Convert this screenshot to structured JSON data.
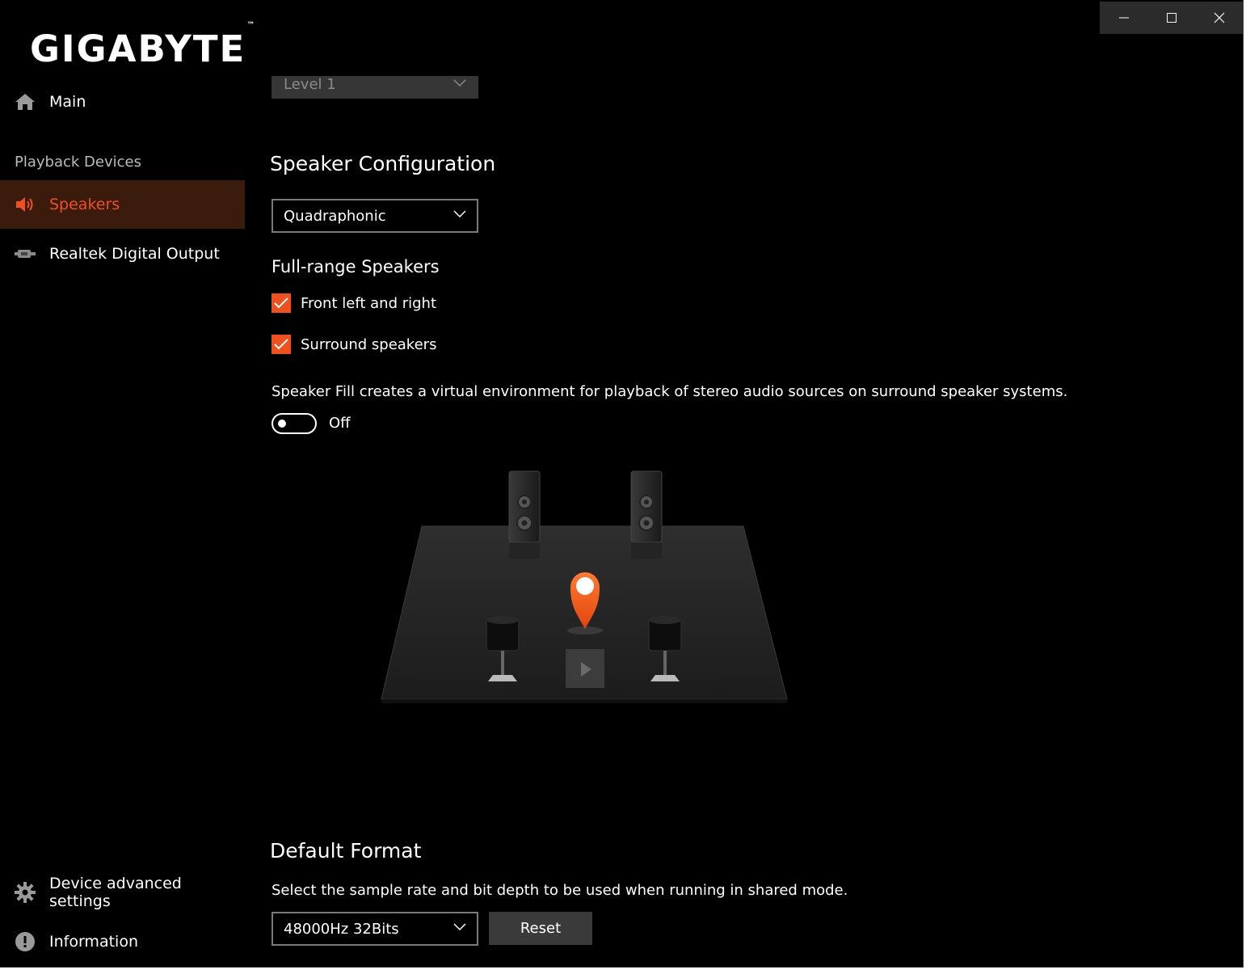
{
  "brand": {
    "name": "GIGABYTE",
    "tm": "™"
  },
  "window_controls": [
    "minimize-icon",
    "maximize-icon",
    "close-icon"
  ],
  "sidebar": {
    "main_label": "Main",
    "section_header": "Playback Devices",
    "devices": [
      {
        "label": "Speakers",
        "icon": "speaker-icon",
        "active": true
      },
      {
        "label": "Realtek Digital Output",
        "icon": "digital-output-icon",
        "active": false
      }
    ],
    "bottom": [
      {
        "label": "Device advanced settings",
        "icon": "gear-icon"
      },
      {
        "label": "Information",
        "icon": "info-icon"
      }
    ]
  },
  "level_dropdown": {
    "value": "Level 1"
  },
  "speaker_config": {
    "title": "Speaker Configuration",
    "selected": "Quadraphonic",
    "full_range_title": "Full-range Speakers",
    "checkboxes": [
      {
        "label": "Front left and right",
        "checked": true
      },
      {
        "label": "Surround speakers",
        "checked": true
      }
    ],
    "speaker_fill_text": "Speaker Fill creates a virtual environment for playback of stereo audio sources on surround speaker systems.",
    "speaker_fill_state": "Off"
  },
  "default_format": {
    "title": "Default Format",
    "description": "Select the sample rate and bit depth to be used when running in shared mode.",
    "selected": "48000Hz 32Bits",
    "reset_label": "Reset"
  },
  "colors": {
    "accent": "#f0501e",
    "background": "#000000",
    "active_item_bg": "#3a1b0c",
    "button_bg": "#3a3a3a"
  }
}
